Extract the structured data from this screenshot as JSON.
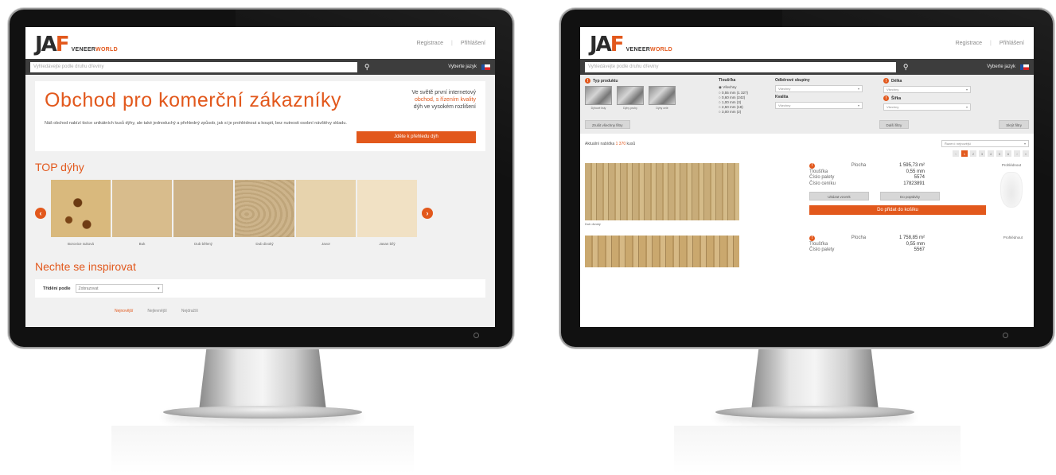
{
  "brand": {
    "logo_mark_a": "JA",
    "logo_mark_b": "F",
    "logo_sub_a": "VENEER",
    "logo_sub_b": "WORLD",
    "accent": "#e2581c",
    "dark_bar": "#3d3d3d"
  },
  "left": {
    "header": {
      "register": "Registrace",
      "login": "Přihlášení"
    },
    "search": {
      "placeholder": "Vyhledávejte podle druhu dřeviny",
      "lang": "Vyberte jazyk"
    },
    "hero": {
      "title": "Obchod pro komerční zákazníky",
      "note_a": "Ve světě první internetový",
      "note_b": "obchod, s řízením kvality",
      "note_c": "dýh ve vysokém rozlišení",
      "text": "Náš obchod nabízí tisíce unikátních kusů dýhy, ale také jednoduchý a přehledný způsob, jak si je prohlédnout a koupit, bez nutnosti osobní návštěvy skladu.",
      "button": "Jděte k přehledu dýh"
    },
    "top_title": "TOP dýhy",
    "tiles": [
      {
        "label": "Borovice suková",
        "bg": "#d9b97d"
      },
      {
        "label": "Buk",
        "bg": "#d8bc8c"
      },
      {
        "label": "Dub bělený",
        "bg": "#cdb287"
      },
      {
        "label": "Dub divoký",
        "bg": "#c6ad85"
      },
      {
        "label": "Javor",
        "bg": "#e7d3ad"
      },
      {
        "label": "Jasan bílý",
        "bg": "#f1e1c4"
      }
    ],
    "inspire_title": "Nechte se inspirovat",
    "filter": {
      "label": "Třídění podle",
      "value": "Zobrazovat"
    },
    "sort": [
      "Nejnovější",
      "Nejlevnější",
      "Nejdražší"
    ]
  },
  "right": {
    "header": {
      "register": "Registrace",
      "login": "Přihlášení"
    },
    "search": {
      "placeholder": "Vyhledávejte podle druhu dřeviny",
      "lang": "Vyberte jazyk"
    },
    "filters": {
      "type_head": "Typ produktu",
      "types": [
        "Dýhové listy",
        "Dýhy pruhy",
        "Dýhy celé"
      ],
      "thickness_head": "Tloušťka",
      "thickness": [
        "Všechny",
        "0,55 mm (1 327)",
        "0,60 mm (242)",
        "1,00 mm (3)",
        "2,50 mm (18)",
        "3,00 mm (2)"
      ],
      "wood_head": "Odběrové skupiny",
      "wood_value": "Všechny",
      "quality_head": "Kvalita",
      "quality_value": "Všechny",
      "length_head": "Délka",
      "length_value": "Všechny",
      "width_head": "Šířka",
      "width_value": "Všechny"
    },
    "actions": {
      "reset": "Zrušit všechny filtry",
      "more": "Další filtry",
      "hide": "Skrýt filtry"
    },
    "count": {
      "prefix": "Aktuální nabídka",
      "number": "1 370",
      "suffix": "kusů",
      "sort": "Řazení: nejnovější"
    },
    "pages": [
      "‹",
      "1",
      "2",
      "3",
      "4",
      "5",
      "6",
      "›",
      "»"
    ],
    "products": [
      {
        "caption": "Dub divoký",
        "rows": [
          {
            "k": "Plocha",
            "v": "1 595,73 m²"
          },
          {
            "k": "Tloušťka",
            "v": "0,55 mm"
          },
          {
            "k": "Číslo palety",
            "v": "5574"
          },
          {
            "k": "Číslo ceníku",
            "v": "17823891"
          }
        ],
        "btn_a": "Ukázat vzorek",
        "btn_b": "Do poptávky",
        "cart": "Do přidat do košíku",
        "preview": "Prohlédnout"
      },
      {
        "caption": "",
        "rows": [
          {
            "k": "Plocha",
            "v": "1 758,85 m²"
          },
          {
            "k": "Tloušťka",
            "v": "0,55 mm"
          },
          {
            "k": "Číslo palety",
            "v": "5567"
          }
        ],
        "preview": "Prohlédnout"
      }
    ]
  }
}
